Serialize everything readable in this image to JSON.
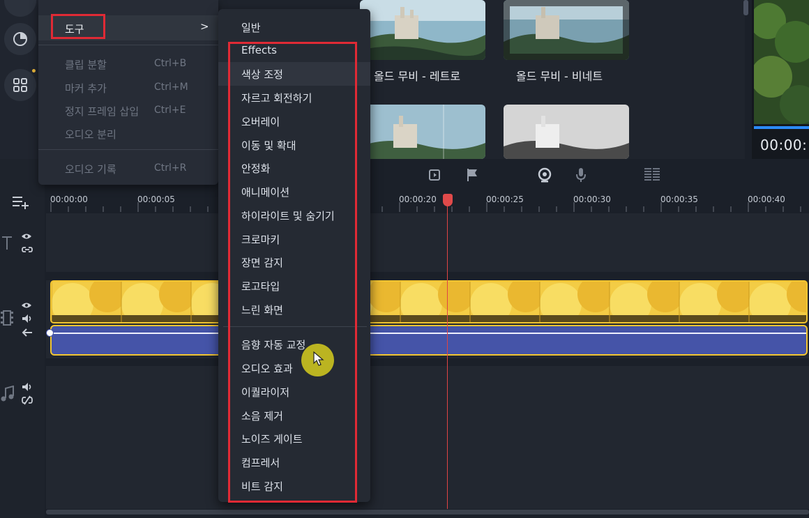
{
  "context_menu": {
    "tools": {
      "label": "도구",
      "arrow": ">"
    },
    "items": [
      {
        "label": "클립 분할",
        "shortcut": "Ctrl+B"
      },
      {
        "label": "마커 추가",
        "shortcut": "Ctrl+M"
      },
      {
        "label": "정지 프레임 삽입",
        "shortcut": "Ctrl+E"
      },
      {
        "label": "오디오 분리",
        "shortcut": ""
      },
      {
        "label": "오디오 기록",
        "shortcut": "Ctrl+R"
      }
    ]
  },
  "submenu": {
    "general": "일반",
    "video_items": [
      "Effects",
      "색상 조정",
      "자르고 회전하기",
      "오버레이",
      "이동 및 확대",
      "안정화",
      "애니메이션",
      "하이라이트 및 숨기기",
      "크로마키",
      "장면 감지",
      "로고타입",
      "느린 화면"
    ],
    "audio_items": [
      "음향 자동 교정",
      "오디오 효과",
      "이퀄라이저",
      "소음 제거",
      "노이즈 게이트",
      "컴프레서",
      "비트 감지"
    ]
  },
  "media": {
    "thumb_labels": [
      "올드 무비 - 레트로",
      "올드 무비 - 비네트"
    ]
  },
  "preview": {
    "time": "00:00:"
  },
  "timeline": {
    "ruler": [
      "00:00:00",
      "00:00:05",
      "00:00:20",
      "00:00:25",
      "00:00:30",
      "00:00:35",
      "00:00:40"
    ]
  },
  "colors": {
    "highlight": "#e02a35",
    "clip_border": "#f2c531",
    "audio_clip": "#4554a8",
    "playhead": "#e04444",
    "cursor": "#d6cd1e"
  },
  "icons": [
    "contrast-icon",
    "grid-icon",
    "add-track-icon",
    "text-track-icon",
    "eye-icon",
    "link-icon",
    "video-track-icon",
    "volume-icon",
    "back-arrow-icon",
    "music-track-icon",
    "unlink-icon",
    "crop-icon",
    "flag-icon",
    "webcam-icon",
    "microphone-icon",
    "audio-levels-icon",
    "chevron-right-icon",
    "mouse-cursor-icon"
  ]
}
